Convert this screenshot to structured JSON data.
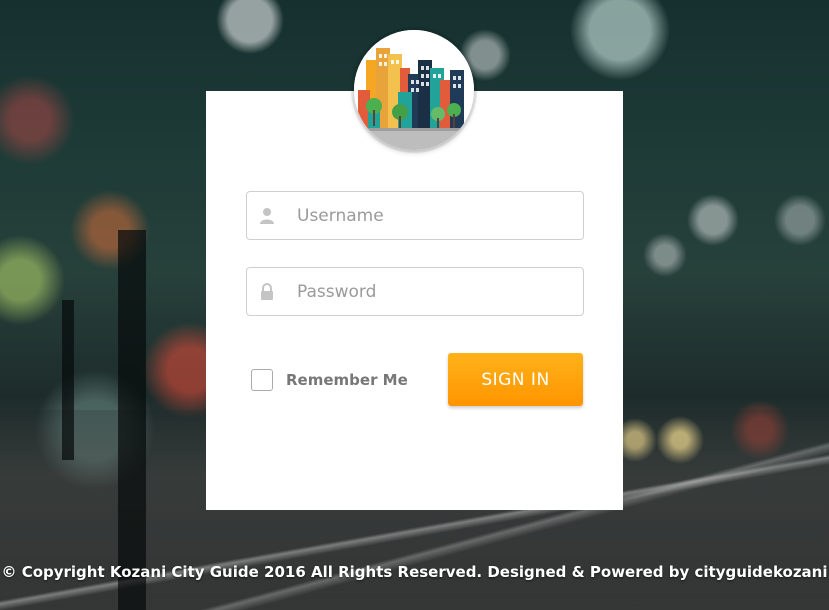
{
  "login": {
    "username": {
      "value": "",
      "placeholder": "Username",
      "icon": "user-icon"
    },
    "password": {
      "value": "",
      "placeholder": "Password",
      "icon": "lock-icon"
    },
    "remember_label": "Remember Me",
    "remember_checked": false,
    "signin_label": "SIGN IN"
  },
  "footer": {
    "copyright": "© Copyright Kozani City Guide 2016 All Rights Reserved. Designed & Powered by cityguidekozani"
  },
  "colors": {
    "accent": "#ff9f0a",
    "card": "#ffffff",
    "input_border": "#cfcfcf"
  }
}
